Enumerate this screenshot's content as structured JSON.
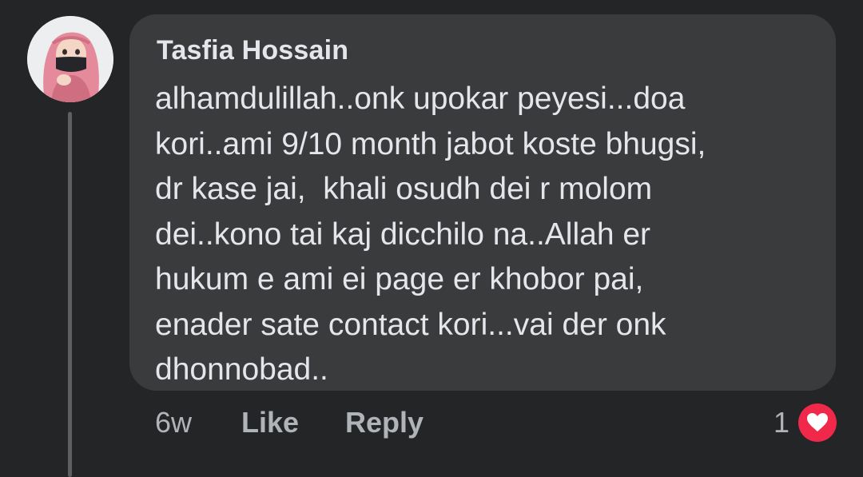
{
  "comment": {
    "author": "Tasfia Hossain",
    "text_lines": [
      "alhamdulillah..onk upokar peyesi...doa",
      "kori..ami 9/10 month jabot koste bhugsi,",
      "dr kase jai,  khali osudh dei r molom",
      "dei..kono tai kaj dicchilo na..Allah er",
      "hukum e ami ei page er khobor pai,",
      "enader sate contact kori...vai der onk",
      "dhonnobad.."
    ],
    "timestamp": "6w",
    "like_label": "Like",
    "reply_label": "Reply",
    "reaction_count": "1",
    "reaction_icon": "heart-love-icon"
  },
  "colors": {
    "background": "#242526",
    "bubble": "#3a3b3c",
    "text_primary": "#e4e6eb",
    "text_secondary": "#b0b3b8",
    "love_reaction": "#f02849"
  }
}
